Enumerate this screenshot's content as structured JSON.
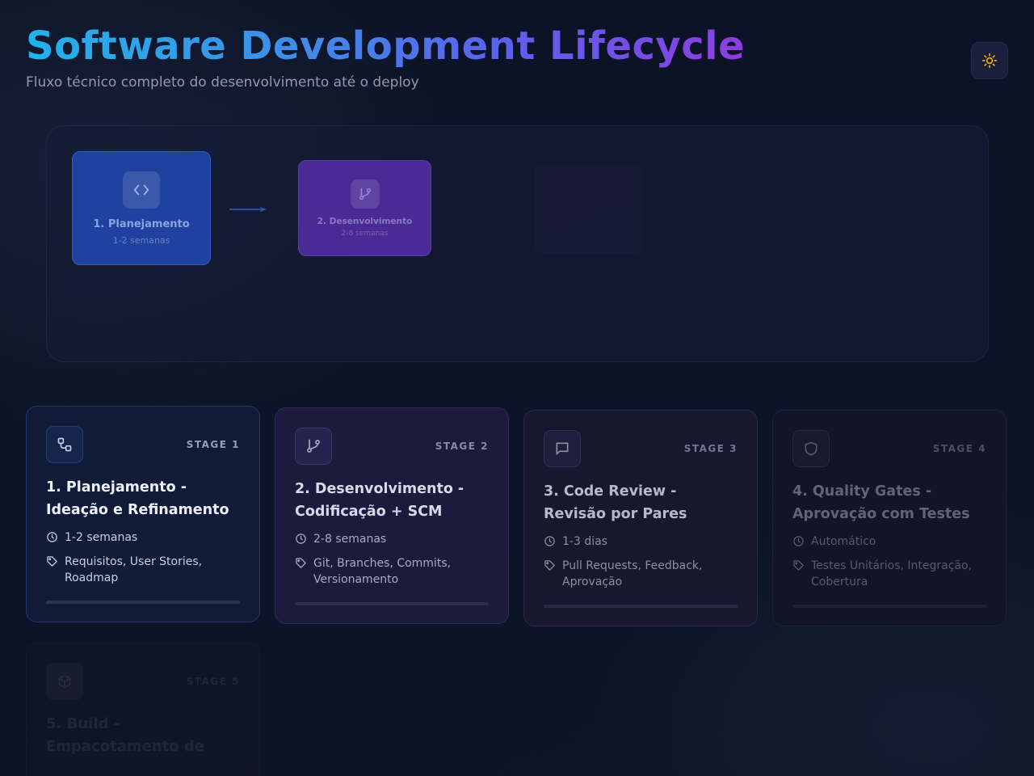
{
  "header": {
    "title": "Software Development Lifecycle",
    "subtitle": "Fluxo técnico completo do desenvolvimento até o deploy",
    "theme_toggle_icon": "sun-icon"
  },
  "flow": {
    "nodes": [
      {
        "label": "1. Planejamento",
        "duration": "1-2 semanas",
        "icon": "code-icon",
        "color": "#1f42a0"
      },
      {
        "label": "2. Desenvolvimento",
        "duration": "2-8 semanas",
        "icon": "git-branch-icon",
        "color": "#4a2b96"
      }
    ]
  },
  "stages": [
    {
      "stage": "STAGE 1",
      "title": "1. Planejamento - Ideação e Refinamento",
      "duration": "1-2 semanas",
      "tags": "Requisitos, User Stories, Roadmap",
      "icon": "workflow-icon"
    },
    {
      "stage": "STAGE 2",
      "title": "2. Desenvolvimento - Codificação + SCM",
      "duration": "2-8 semanas",
      "tags": "Git, Branches, Commits, Versionamento",
      "icon": "git-branch-icon"
    },
    {
      "stage": "STAGE 3",
      "title": "3. Code Review - Revisão por Pares",
      "duration": "1-3 dias",
      "tags": "Pull Requests, Feedback, Aprovação",
      "icon": "message-icon"
    },
    {
      "stage": "STAGE 4",
      "title": "4. Quality Gates - Aprovação com Testes",
      "duration": "Automático",
      "tags": "Testes Unitários, Integração, Cobertura",
      "icon": "shield-icon"
    },
    {
      "stage": "STAGE 5",
      "title": "5. Build - Empacotamento de",
      "icon": "package-icon"
    }
  ],
  "colors": {
    "title_gradient_start": "#22b3ea",
    "title_gradient_end": "#8b3de0",
    "sun_icon": "#f5a623"
  }
}
